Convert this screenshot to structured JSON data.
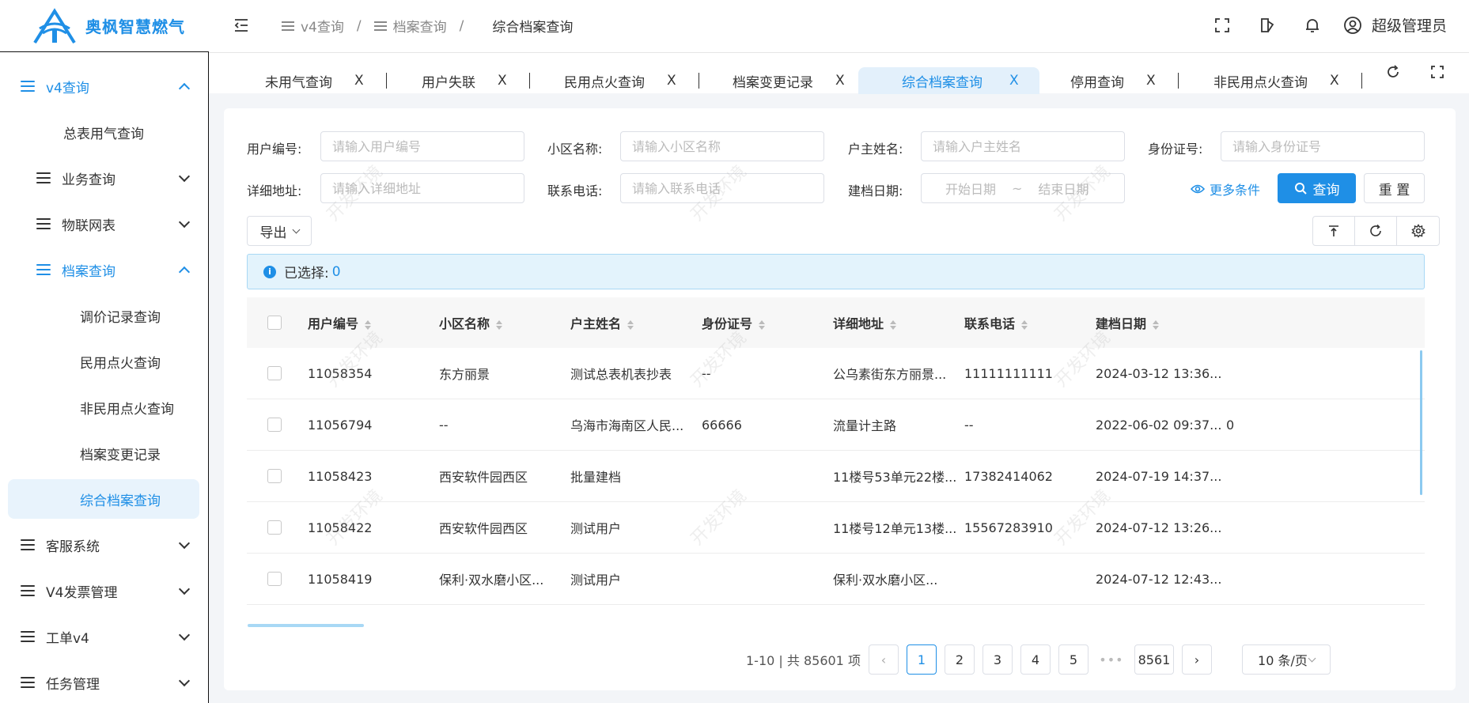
{
  "app": {
    "brand": "奥枫智慧燃气"
  },
  "sidebar": {
    "items": [
      {
        "label": "v4查询"
      },
      {
        "label": "总表用气查询"
      },
      {
        "label": "业务查询"
      },
      {
        "label": "物联网表"
      },
      {
        "label": "档案查询"
      },
      {
        "label": "调价记录查询"
      },
      {
        "label": "民用点火查询"
      },
      {
        "label": "非民用点火查询"
      },
      {
        "label": "档案变更记录"
      },
      {
        "label": "综合档案查询"
      },
      {
        "label": "客服系统"
      },
      {
        "label": "V4发票管理"
      },
      {
        "label": "工单v4"
      },
      {
        "label": "任务管理"
      }
    ]
  },
  "header": {
    "breadcrumb": [
      "v4查询",
      "档案查询",
      "综合档案查询"
    ],
    "breadcrumb_sep": "/",
    "user": "超级管理员"
  },
  "tabs": [
    {
      "label": "未用气查询",
      "close": "X"
    },
    {
      "label": "用户失联",
      "close": "X"
    },
    {
      "label": "民用点火查询",
      "close": "X"
    },
    {
      "label": "档案变更记录",
      "close": "X"
    },
    {
      "label": "综合档案查询",
      "close": "X"
    },
    {
      "label": "停用查询",
      "close": "X"
    },
    {
      "label": "非民用点火查询",
      "close": "X"
    }
  ],
  "filters": {
    "user_no": {
      "label": "用户编号:",
      "placeholder": "请输入用户编号"
    },
    "community": {
      "label": "小区名称:",
      "placeholder": "请输入小区名称"
    },
    "owner": {
      "label": "户主姓名:",
      "placeholder": "请输入户主姓名"
    },
    "id_card": {
      "label": "身份证号:",
      "placeholder": "请输入身份证号"
    },
    "address": {
      "label": "详细地址:",
      "placeholder": "请输入详细地址"
    },
    "phone": {
      "label": "联系电话:",
      "placeholder": "请输入联系电话"
    },
    "created": {
      "label": "建档日期:",
      "start": "开始日期",
      "tilde": "~",
      "end": "结束日期"
    },
    "more": "更多条件",
    "search": "查询",
    "reset": "重 置",
    "export": "导出"
  },
  "selection": {
    "label": "已选择:",
    "count": "0"
  },
  "table": {
    "columns": [
      "用户编号",
      "小区名称",
      "户主姓名",
      "身份证号",
      "详细地址",
      "联系电话",
      "建档日期"
    ],
    "rows": [
      [
        "11058354",
        "东方丽景",
        "测试总表机表抄表",
        "--",
        "公乌素街东方丽景...",
        "11111111111",
        "2024-03-12 13:36...",
        ""
      ],
      [
        "11056794",
        "--",
        "乌海市海南区人民...",
        "66666",
        "流量计主路",
        "--",
        "2022-06-02 09:37...",
        "0"
      ],
      [
        "11058423",
        "西安软件园西区",
        "批量建档",
        "",
        "11楼号53单元22楼...",
        "17382414062",
        "2024-07-19 14:37...",
        ""
      ],
      [
        "11058422",
        "西安软件园西区",
        "测试用户",
        "",
        "11楼号12单元13楼...",
        "15567283910",
        "2024-07-12 13:26...",
        ""
      ],
      [
        "11058419",
        "保利·双水磨小区...",
        "测试用户",
        "",
        "保利·双水磨小区...",
        "",
        "2024-07-12 12:43...",
        ""
      ]
    ]
  },
  "pagination": {
    "summary": "1-10 | 共 85601 项",
    "pages": [
      "1",
      "2",
      "3",
      "4",
      "5"
    ],
    "dots": "•••",
    "last": "8561",
    "page_size": "10 条/页"
  },
  "watermark": "开发环境",
  "colors": {
    "accent": "#1f8fe6"
  }
}
